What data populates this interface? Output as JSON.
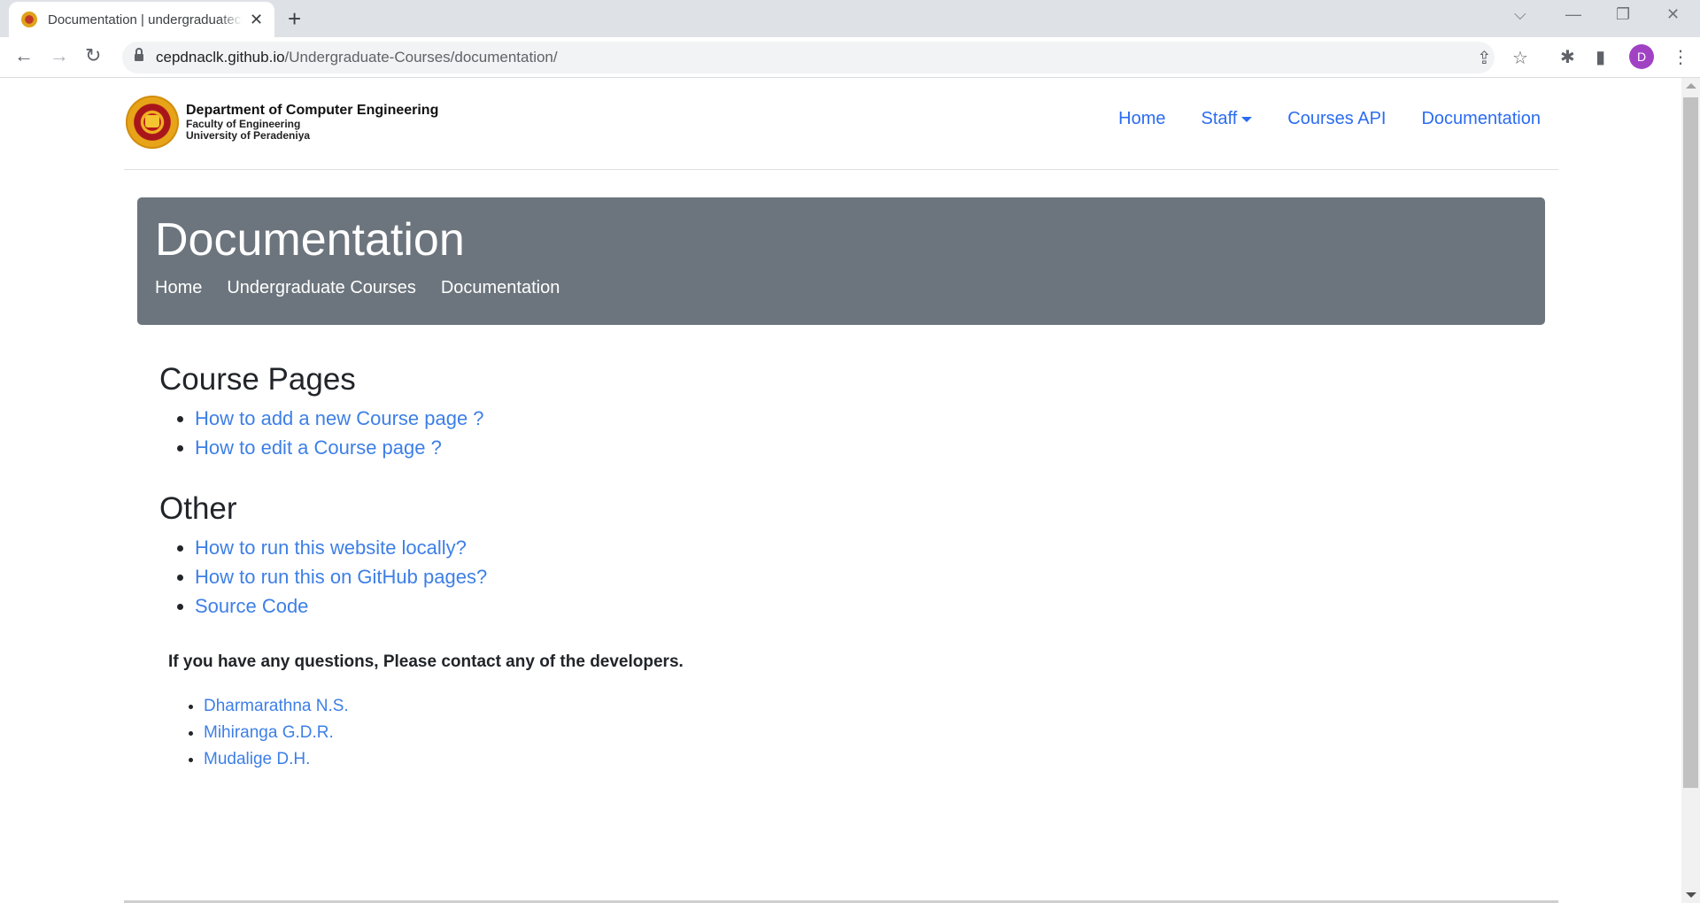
{
  "browser": {
    "tab": {
      "title": "Documentation | undergraduatecourses",
      "close_icon": "close-icon",
      "favicon": "university-crest-icon"
    },
    "new_tab_label": "+",
    "window_controls": {
      "tab_search": "chevron-down-icon",
      "minimize": "minimize-icon",
      "restore": "restore-icon",
      "close": "close-icon"
    },
    "nav": {
      "back": "←",
      "forward": "→",
      "reload": "↻"
    },
    "url": {
      "host": "cepdnaclk.github.io",
      "path": "/Undergraduate-Courses/documentation/"
    },
    "profile_initial": "D"
  },
  "site": {
    "brand": {
      "line1": "Department of  Computer Engineering",
      "line2": "Faculty of Engineering",
      "line3": "University of Peradeniya"
    },
    "nav": [
      {
        "label": "Home"
      },
      {
        "label": "Staff",
        "dropdown": true
      },
      {
        "label": "Courses API"
      },
      {
        "label": "Documentation"
      }
    ]
  },
  "jumbotron": {
    "title": "Documentation",
    "breadcrumbs": [
      "Home",
      "Undergraduate Courses",
      "Documentation"
    ]
  },
  "sections": [
    {
      "title": "Course Pages",
      "links": [
        "How to add a new Course page ?",
        "How to edit a Course page ?"
      ]
    },
    {
      "title": "Other",
      "links": [
        "How to run this website locally?",
        "How to run this on GitHub pages?",
        "Source Code"
      ]
    }
  ],
  "contact": {
    "text": "If you have any questions, Please contact any of the developers.",
    "developers": [
      "Dharmarathna N.S.",
      "Mihiranga G.D.R.",
      "Mudalige D.H."
    ]
  }
}
